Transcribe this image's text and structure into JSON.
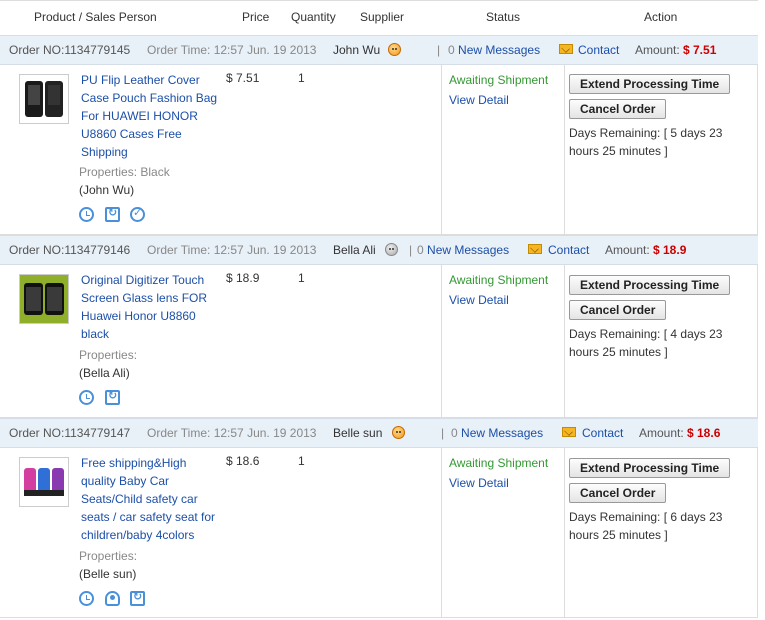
{
  "header": {
    "product": "Product / Sales Person",
    "price": "Price",
    "quantity": "Quantity",
    "supplier": "Supplier",
    "status": "Status",
    "action": "Action"
  },
  "labels": {
    "order_no": "Order NO:",
    "order_time": "Order Time:",
    "new_messages": "New Messages",
    "contact": "Contact",
    "amount": "Amount:",
    "extend": "Extend Processing Time",
    "cancel": "Cancel Order",
    "view_detail": "View Detail",
    "days_remaining": "Days Remaining: [",
    "days_close": "]",
    "properties": "Properties:"
  },
  "orders": [
    {
      "order_no": "1134779145",
      "order_time": "12:57 Jun. 19 2013",
      "supplier": "John Wu",
      "supplier_online": true,
      "messages": "0",
      "amount": "$ 7.51",
      "title": "PU Flip Leather Cover Case Pouch Fashion Bag For HUAWEI HONOR U8860 Cases Free Shipping",
      "properties_value": "Black",
      "seller": "(John Wu)",
      "price": "$ 7.51",
      "quantity": "1",
      "status": "Awaiting Shipment",
      "days": "5 days 23 hours 25 minutes",
      "icons": [
        "clock-icon",
        "refresh-icon",
        "check-icon"
      ]
    },
    {
      "order_no": "1134779146",
      "order_time": "12:57 Jun. 19 2013",
      "supplier": "Bella Ali",
      "supplier_online": false,
      "messages": "0",
      "amount": "$ 18.9",
      "title": "Original Digitizer Touch Screen Glass lens FOR Huawei Honor U8860 black",
      "properties_value": "",
      "seller": "(Bella Ali)",
      "price": "$ 18.9",
      "quantity": "1",
      "status": "Awaiting Shipment",
      "days": "4 days 23 hours 25 minutes",
      "icons": [
        "clock-icon",
        "refresh-icon"
      ]
    },
    {
      "order_no": "1134779147",
      "order_time": "12:57 Jun. 19 2013",
      "supplier": "Belle sun",
      "supplier_online": true,
      "messages": "0",
      "amount": "$ 18.6",
      "title": "Free shipping&High quality Baby Car Seats/Child safety car seats / car safety seat for children/baby 4colors",
      "properties_value": "",
      "seller": "(Belle sun)",
      "price": "$ 18.6",
      "quantity": "1",
      "status": "Awaiting Shipment",
      "days": "6 days 23 hours 25 minutes",
      "icons": [
        "clock-icon",
        "person-icon",
        "refresh-icon"
      ]
    }
  ]
}
